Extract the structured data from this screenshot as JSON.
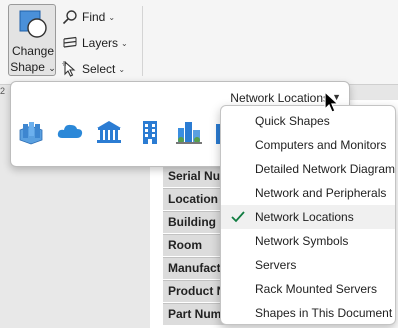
{
  "ribbon": {
    "change_shape": {
      "line1": "Change",
      "line2": "Shape",
      "chevron": "⌄",
      "icon": "change-shape-icon"
    },
    "find": {
      "label": "Find",
      "chevron": "⌄",
      "icon": "search-icon"
    },
    "layers": {
      "label": "Layers",
      "chevron": "⌄",
      "icon": "layers-icon"
    },
    "select": {
      "label": "Select",
      "chevron": "⌄",
      "icon": "pointer-icon"
    }
  },
  "ruler": {
    "mark": "2"
  },
  "gallery": {
    "dropdown_label": "Network Locations",
    "stencils": [
      "servers-stack-icon",
      "cloud-icon",
      "government-building-icon",
      "office-building-icon",
      "city-icon",
      "partial-building-icon"
    ]
  },
  "menu": {
    "items": [
      {
        "label": "Quick Shapes",
        "checked": false
      },
      {
        "label": "Computers and Monitors",
        "checked": false
      },
      {
        "label": "Detailed Network Diagram",
        "checked": false
      },
      {
        "label": "Network and Peripherals",
        "checked": false
      },
      {
        "label": "Network Locations",
        "checked": true
      },
      {
        "label": "Network Symbols",
        "checked": false
      },
      {
        "label": "Servers",
        "checked": false
      },
      {
        "label": "Rack Mounted Servers",
        "checked": false
      },
      {
        "label": "Shapes in This Document",
        "checked": false
      }
    ]
  },
  "shape_data": {
    "rows": [
      "Serial Number",
      "Location",
      "Building",
      "Room",
      "Manufacturer",
      "Product Number",
      "Part Number"
    ]
  },
  "colors": {
    "accent": "#2b7cd3",
    "check": "#107c41",
    "cloud": "#2b88d8"
  }
}
